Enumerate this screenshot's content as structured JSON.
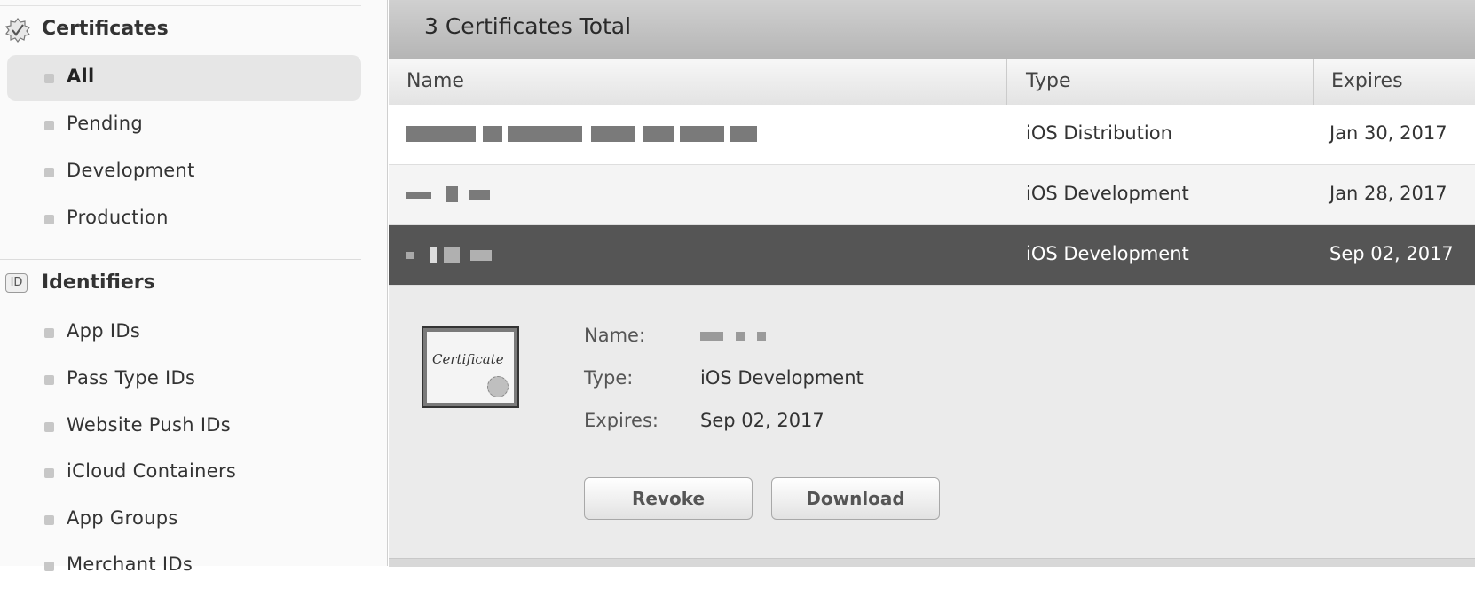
{
  "sidebar": {
    "certificates": {
      "title": "Certificates",
      "icon": "checkmark-seal-icon",
      "items": [
        {
          "label": "All",
          "active": true
        },
        {
          "label": "Pending"
        },
        {
          "label": "Development"
        },
        {
          "label": "Production"
        }
      ]
    },
    "identifiers": {
      "title": "Identifiers",
      "badge": "ID",
      "items": [
        {
          "label": "App IDs"
        },
        {
          "label": "Pass Type IDs"
        },
        {
          "label": "Website Push IDs"
        },
        {
          "label": "iCloud Containers"
        },
        {
          "label": "App Groups"
        },
        {
          "label": "Merchant IDs"
        }
      ]
    }
  },
  "main": {
    "title": "3 Certificates Total",
    "columns": {
      "name": "Name",
      "type": "Type",
      "expires": "Expires"
    },
    "rows": [
      {
        "name": "[redacted]",
        "type": "iOS Distribution",
        "expires": "Jan 30, 2017"
      },
      {
        "name": "[redacted]",
        "type": "iOS Development",
        "expires": "Jan 28, 2017"
      },
      {
        "name": "[redacted]",
        "type": "iOS Development",
        "expires": "Sep 02, 2017",
        "selected": true
      }
    ],
    "detail": {
      "thumbnail_text": "Certificate",
      "name_label": "Name:",
      "name_value": "[redacted]",
      "type_label": "Type:",
      "type_value": "iOS Development",
      "expires_label": "Expires:",
      "expires_value": "Sep 02, 2017",
      "revoke_label": "Revoke",
      "download_label": "Download"
    }
  },
  "colors": {
    "selected_row": "#555555",
    "title_bar": "#c0c0c0",
    "sidebar_active": "#e6e6e6"
  }
}
